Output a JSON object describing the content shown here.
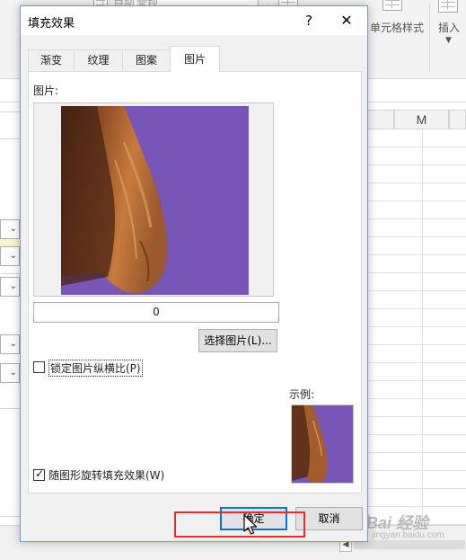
{
  "ribbon": {
    "wrap_text": "自动换行",
    "number_format": "常规",
    "cell_styles": "单元格样式",
    "insert": "插入"
  },
  "columns": {
    "m": "M"
  },
  "dialog": {
    "title": "填充效果",
    "help": "?",
    "close": "✕",
    "tabs": [
      {
        "label": "渐变"
      },
      {
        "label": "纹理"
      },
      {
        "label": "图案"
      },
      {
        "label": "图片"
      }
    ],
    "picture_label": "图片:",
    "picture_name": "0",
    "select_picture": "选择图片(L)...",
    "lock_aspect": "锁定图片纵横比(P)",
    "lock_aspect_checked": false,
    "sample_label": "示例:",
    "rotate_with_shape": "随图形旋转填充效果(W)",
    "rotate_with_shape_checked": true,
    "ok": "确定",
    "cancel": "取消"
  },
  "watermark": {
    "main": "Bai 经验",
    "sub": "jingyan.baidu.com"
  },
  "colors": {
    "image_background": "#7856b7",
    "highlight": "#e0302a",
    "focus": "#0078d7"
  }
}
